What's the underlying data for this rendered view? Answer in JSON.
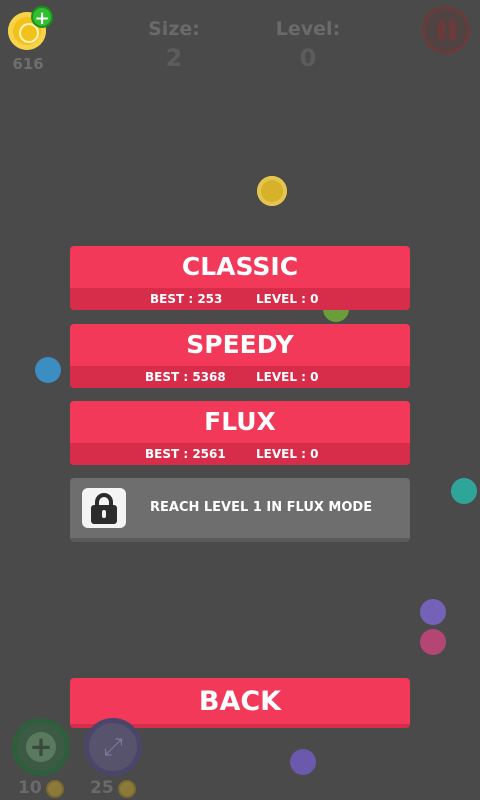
{
  "hud": {
    "coins": "616",
    "add_coins_symbol": "+",
    "size_label": "Size:",
    "size_value": "2",
    "level_label": "Level:",
    "level_value": "0"
  },
  "modes": [
    {
      "title": "CLASSIC",
      "best": "BEST : 253",
      "level": "LEVEL : 0"
    },
    {
      "title": "SPEEDY",
      "best": "BEST : 5368",
      "level": "LEVEL : 0"
    },
    {
      "title": "FLUX",
      "best": "BEST : 2561",
      "level": "LEVEL : 0"
    }
  ],
  "locked_mode": {
    "text": "REACH LEVEL 1 IN FLUX MODE"
  },
  "back_label": "BACK",
  "powerups": {
    "grow": {
      "symbol": "+",
      "cost": "10"
    },
    "expand": {
      "symbol": "⤢",
      "cost": "25"
    }
  },
  "colors": {
    "background": "#4a4a4a",
    "accent": "#f2395a",
    "accent_dark": "#d82c4b",
    "locked": "#6e6e6e"
  }
}
